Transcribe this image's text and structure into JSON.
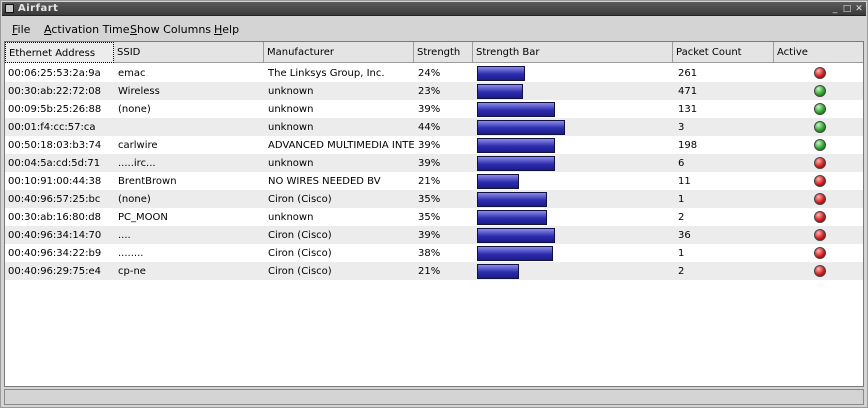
{
  "window": {
    "title": "Airfart"
  },
  "menu": {
    "file": {
      "underline": "F",
      "rest": "ile"
    },
    "activation_time": {
      "underline": "A",
      "rest": "ctivation Time"
    },
    "show_columns": {
      "underline": "S",
      "rest": "how Columns"
    },
    "help": {
      "underline": "H",
      "rest": "elp"
    }
  },
  "columns": [
    "Ethernet Address",
    "SSID",
    "Manufacturer",
    "Strength",
    "Strength Bar",
    "Packet Count",
    "Active"
  ],
  "rows": [
    {
      "mac": "00:06:25:53:2a:9a",
      "ssid": "emac",
      "manufacturer": "The Linksys Group, Inc.",
      "strength": "24%",
      "strength_value": 24,
      "packets": "261",
      "active": false
    },
    {
      "mac": "00:30:ab:22:72:08",
      "ssid": "Wireless",
      "manufacturer": "unknown",
      "strength": "23%",
      "strength_value": 23,
      "packets": "471",
      "active": true
    },
    {
      "mac": "00:09:5b:25:26:88",
      "ssid": "(none)",
      "manufacturer": "unknown",
      "strength": "39%",
      "strength_value": 39,
      "packets": "131",
      "active": true
    },
    {
      "mac": "00:01:f4:cc:57:ca",
      "ssid": "",
      "manufacturer": "unknown",
      "strength": "44%",
      "strength_value": 44,
      "packets": "3",
      "active": true
    },
    {
      "mac": "00:50:18:03:b3:74",
      "ssid": "carlwire",
      "manufacturer": "ADVANCED MULTIMEDIA INTE",
      "strength": "39%",
      "strength_value": 39,
      "packets": "198",
      "active": true
    },
    {
      "mac": "00:04:5a:cd:5d:71",
      "ssid": ".....irc...",
      "manufacturer": "unknown",
      "strength": "39%",
      "strength_value": 39,
      "packets": "6",
      "active": false
    },
    {
      "mac": "00:10:91:00:44:38",
      "ssid": "BrentBrown",
      "manufacturer": "NO WIRES NEEDED BV",
      "strength": "21%",
      "strength_value": 21,
      "packets": "11",
      "active": false
    },
    {
      "mac": "00:40:96:57:25:bc",
      "ssid": "(none)",
      "manufacturer": "Ciron (Cisco)",
      "strength": "35%",
      "strength_value": 35,
      "packets": "1",
      "active": false
    },
    {
      "mac": "00:30:ab:16:80:d8",
      "ssid": "PC_MOON",
      "manufacturer": "unknown",
      "strength": "35%",
      "strength_value": 35,
      "packets": "2",
      "active": false
    },
    {
      "mac": "00:40:96:34:14:70",
      "ssid": "....",
      "manufacturer": "Ciron (Cisco)",
      "strength": "39%",
      "strength_value": 39,
      "packets": "36",
      "active": false
    },
    {
      "mac": "00:40:96:34:22:b9",
      "ssid": "........",
      "manufacturer": "Ciron (Cisco)",
      "strength": "38%",
      "strength_value": 38,
      "packets": "1",
      "active": false
    },
    {
      "mac": "00:40:96:29:75:e4",
      "ssid": "cp-ne",
      "manufacturer": "Ciron (Cisco)",
      "strength": "21%",
      "strength_value": 21,
      "packets": "2",
      "active": false
    }
  ],
  "colors": {
    "active_on": "#2fa52f",
    "active_off": "#d42020",
    "strength_bar": "#2d2dae"
  }
}
